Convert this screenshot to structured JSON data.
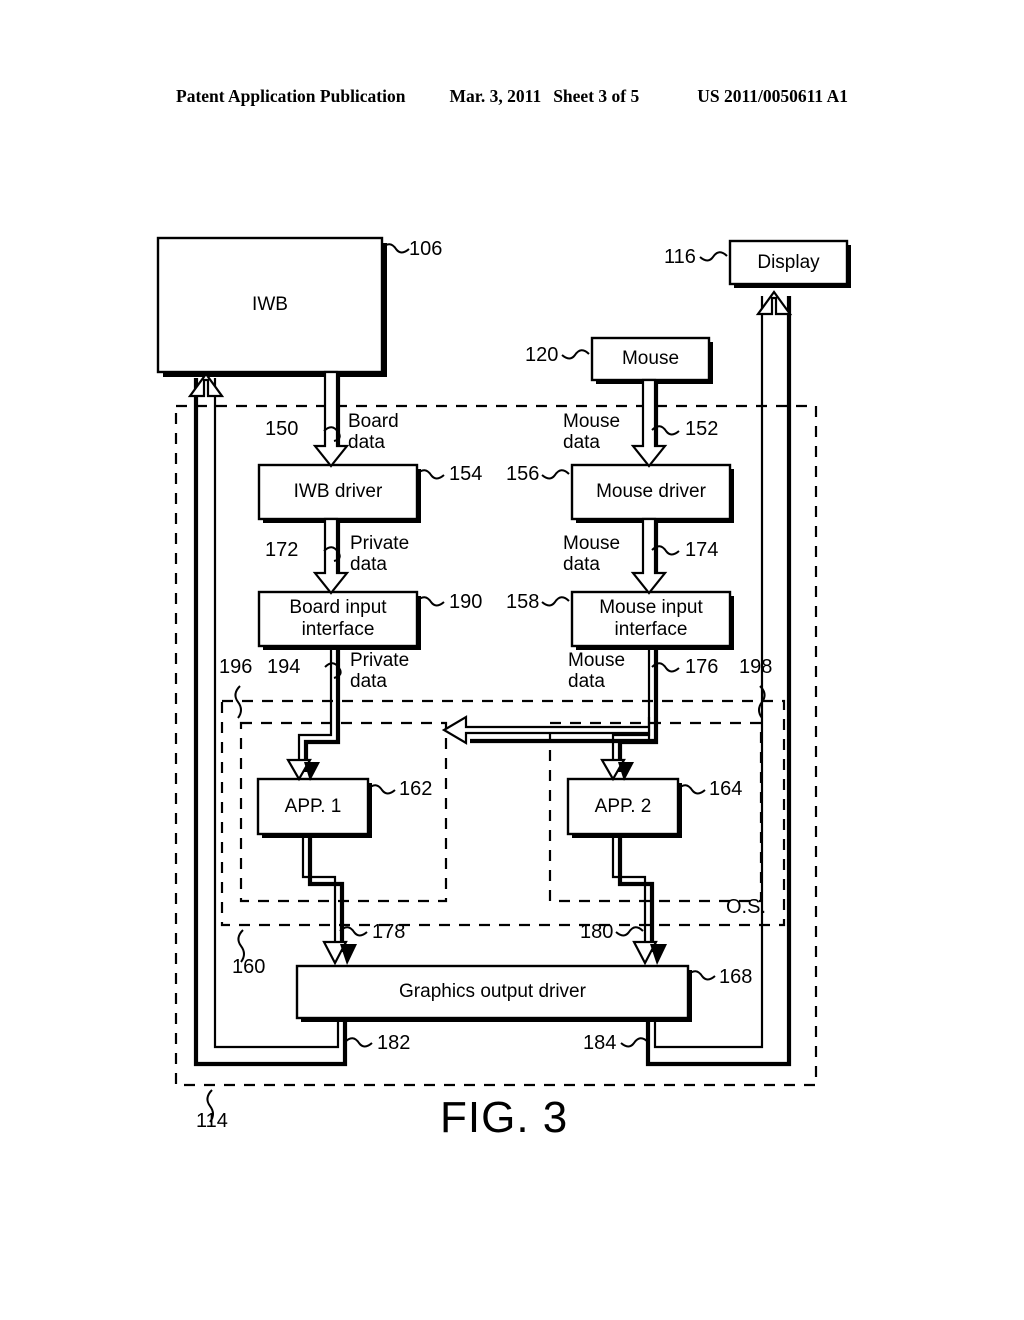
{
  "header": {
    "publication": "Patent Application Publication",
    "date": "Mar. 3, 2011",
    "sheet": "Sheet 3 of 5",
    "patent_number": "US 2011/0050611 A1"
  },
  "figure": {
    "caption": "FIG. 3",
    "outer_ref": "114"
  },
  "boxes": {
    "iwb": {
      "label": "IWB",
      "ref": "106"
    },
    "display": {
      "label": "Display",
      "ref": "116"
    },
    "mouse": {
      "label": "Mouse",
      "ref": "120"
    },
    "iwb_driver": {
      "label": "IWB driver",
      "ref": "154"
    },
    "mouse_driver": {
      "label": "Mouse driver",
      "ref": "156"
    },
    "board_input_interface": {
      "label": "Board input\ninterface",
      "ref": "190"
    },
    "mouse_input_interface": {
      "label": "Mouse input\ninterface",
      "ref": "158"
    },
    "app1": {
      "label": "APP. 1",
      "ref": "162"
    },
    "app2": {
      "label": "APP. 2",
      "ref": "164"
    },
    "graphics_output_driver": {
      "label": "Graphics output driver",
      "ref": "168"
    }
  },
  "regions": {
    "os": {
      "label": "O.S.",
      "ref": "160"
    },
    "app1_container": {
      "ref": "196"
    },
    "app2_container": {
      "ref": "198"
    }
  },
  "flows": {
    "board_data_to_driver": {
      "label": "Board\ndata",
      "ref": "150"
    },
    "mouse_data_to_driver": {
      "label": "Mouse\ndata",
      "ref": "152"
    },
    "private_data_to_board_iface": {
      "label": "Private\ndata",
      "ref": "172"
    },
    "mouse_data_to_mouse_iface": {
      "label": "Mouse\ndata",
      "ref": "174"
    },
    "private_data_to_app1": {
      "label": "Private\ndata",
      "ref": "194"
    },
    "mouse_data_to_app2": {
      "label": "Mouse\ndata",
      "ref": "176"
    },
    "app1_to_graphics": {
      "ref": "178"
    },
    "app2_to_graphics": {
      "ref": "180"
    },
    "graphics_feedback_left": {
      "ref": "182"
    },
    "graphics_feedback_right": {
      "ref": "184"
    }
  },
  "colors": {
    "ink": "#000000",
    "paper": "#ffffff"
  }
}
